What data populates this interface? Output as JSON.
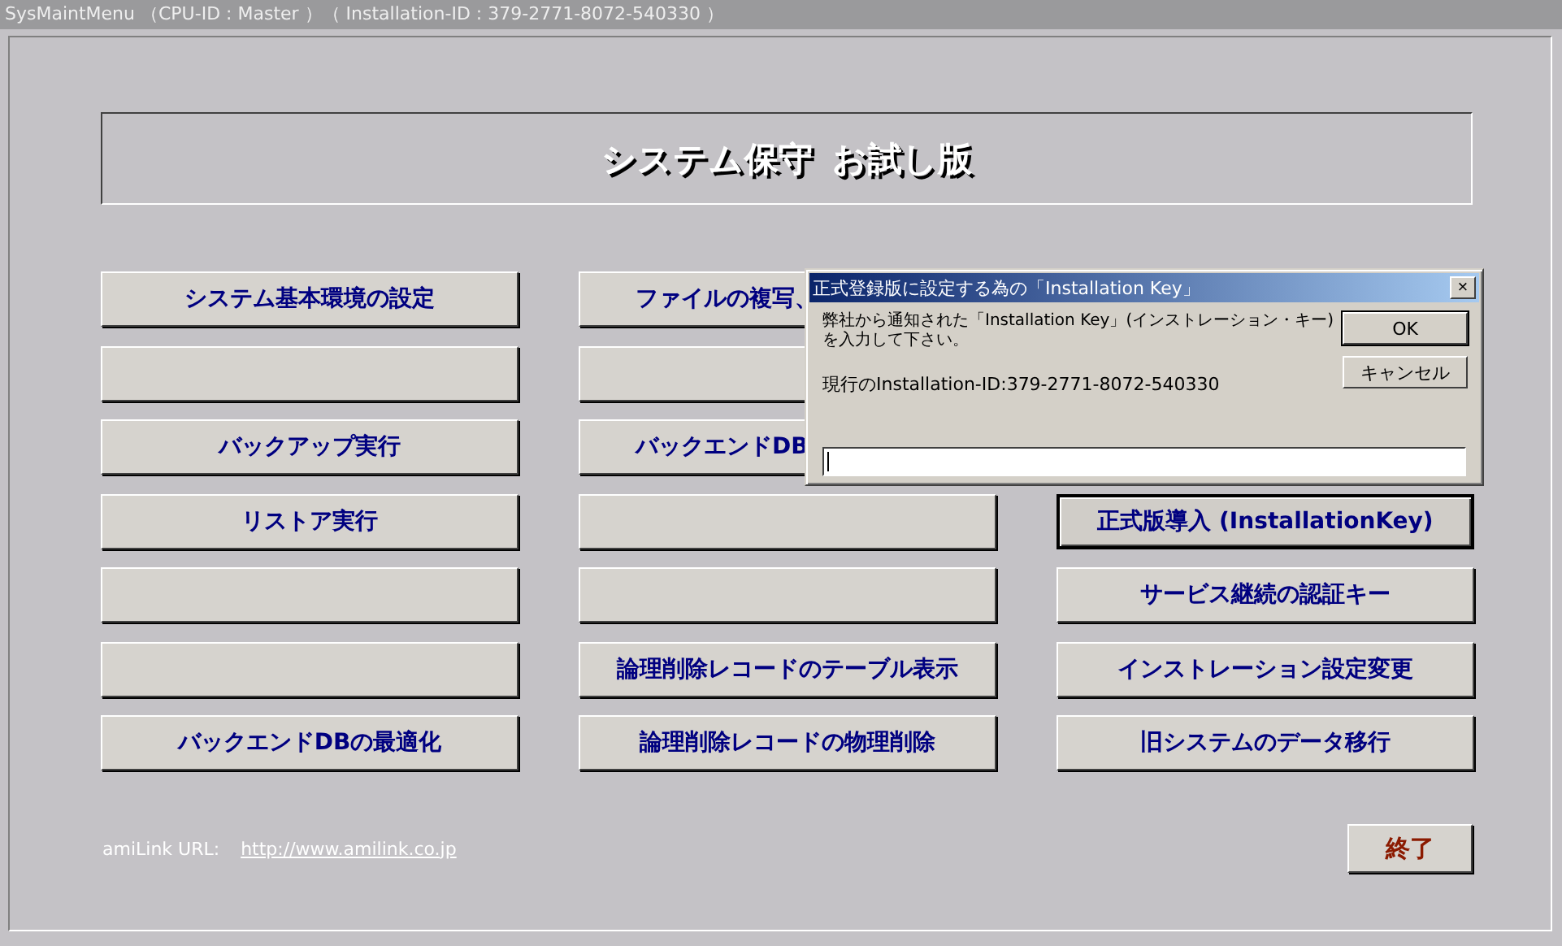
{
  "window": {
    "title": "SysMaintMenu （CPU-ID : Master ）（ Installation-ID : 379-2771-8072-540330 ）"
  },
  "heading": {
    "main": "システム保守",
    "sub": "お試し版"
  },
  "columns": [
    [
      {
        "kind": "full",
        "label": "システム基本環境の設定",
        "focused": false
      },
      {
        "kind": "blank",
        "focused": false
      },
      {
        "kind": "full",
        "label": "バックアップ実行",
        "focused": false
      },
      {
        "kind": "full",
        "label": "リストア実行",
        "focused": false
      },
      {
        "kind": "blank",
        "focused": false
      },
      {
        "kind": "blank",
        "focused": false
      },
      {
        "kind": "full",
        "label": "バックエンドDBの最適化",
        "focused": false
      }
    ],
    [
      {
        "kind": "partial",
        "label": "ファイルの複写、",
        "focused": false
      },
      {
        "kind": "blank",
        "focused": false
      },
      {
        "kind": "partial",
        "label": "バックエンドDB",
        "focused": false
      },
      {
        "kind": "blank",
        "focused": false
      },
      {
        "kind": "blank",
        "focused": false
      },
      {
        "kind": "full",
        "label": "論理削除レコードのテーブル表示",
        "focused": false
      },
      {
        "kind": "full",
        "label": "論理削除レコードの物理削除",
        "focused": false
      }
    ],
    [
      {
        "kind": "hidden"
      },
      {
        "kind": "hidden"
      },
      {
        "kind": "hidden"
      },
      {
        "kind": "full",
        "label": "正式版導入 (InstallationKey)",
        "focused": true
      },
      {
        "kind": "full",
        "label": "サービス継続の認証キー",
        "focused": false
      },
      {
        "kind": "full",
        "label": "インストレーション設定変更",
        "focused": false
      },
      {
        "kind": "full",
        "label": "旧システムのデータ移行",
        "focused": false
      }
    ]
  ],
  "footer": {
    "label": "amiLink URL:",
    "link": "http://www.amilink.co.jp",
    "exit_button": "終了"
  },
  "dialog": {
    "title": "正式登録版に設定する為の「Installation Key」",
    "close": "×",
    "message": "弊社から通知された「Installation Key」(インストレーション・キー)を入力して下さい。",
    "current_id": "現行のInstallation-ID:379-2771-8072-540330",
    "buttons": [
      "OK",
      "キャンセル"
    ]
  }
}
